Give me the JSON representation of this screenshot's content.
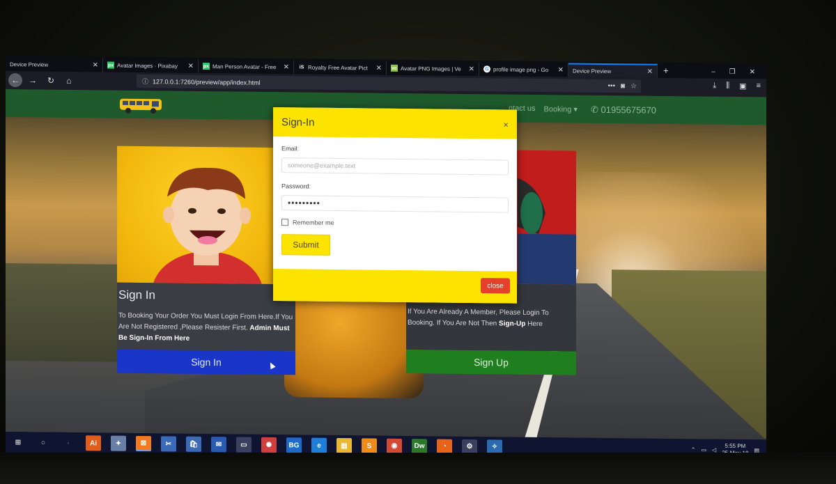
{
  "browser": {
    "tabs": [
      {
        "label": "Device Preview",
        "favicon": "",
        "active": false
      },
      {
        "label": "Avatar Images · Pixabay",
        "favicon": "px",
        "active": false
      },
      {
        "label": "Man Person Avatar - Free",
        "favicon": "px",
        "active": false
      },
      {
        "label": "Royalty Free Avatar Pict",
        "favicon": "iS",
        "active": false
      },
      {
        "label": "Avatar PNG Images | Ve",
        "favicon": "vc",
        "active": false
      },
      {
        "label": "profile image png - Go",
        "favicon": "G",
        "active": false
      },
      {
        "label": "Device Preview",
        "favicon": "",
        "active": true
      }
    ],
    "new_tab": "+",
    "url": "127.0.0.1:7260/preview/app/index.html",
    "url_actions": [
      "•••",
      "pocket-icon",
      "star-icon"
    ],
    "window_buttons": [
      "–",
      "❐",
      "✕"
    ]
  },
  "site": {
    "nav_links": [
      "ntact us",
      "Booking ▾"
    ],
    "phone": "✆ 01955675670",
    "left_card": {
      "title": "Sign In",
      "text": "To Booking Your Order You Must Login From Here.If You Are Not Registered ,Please Resister First.",
      "text_bold": "Admin Must Be Sign-In From Here",
      "button": "Sign In"
    },
    "right_card": {
      "text": "If You Are Already A Member, Please Login To Booking. If You Are Not Then",
      "text_bold": "Sign-Up",
      "text_tail": "Here",
      "button": "Sign Up"
    }
  },
  "modal": {
    "title": "Sign-In",
    "close_x": "×",
    "email_label": "Email:",
    "email_placeholder": "someone@example.text",
    "password_label": "Password:",
    "password_value": "•••••••••",
    "remember_label": "Remember me",
    "submit_label": "Submit",
    "close_label": "close"
  },
  "taskbar": {
    "apps": [
      {
        "name": "illustrator",
        "glyph": "Ai",
        "color": "#e35d1a"
      },
      {
        "name": "app-bird",
        "glyph": "✦",
        "color": "#6a7fa8"
      },
      {
        "name": "xampp",
        "glyph": "⊠",
        "color": "#f47a20"
      },
      {
        "name": "snip",
        "glyph": "✂",
        "color": "#3a6ab8"
      },
      {
        "name": "store",
        "glyph": "🛍",
        "color": "#3a6ab8"
      },
      {
        "name": "mail",
        "glyph": "✉",
        "color": "#2a5bb0"
      },
      {
        "name": "screen",
        "glyph": "▭",
        "color": "#3a4060"
      },
      {
        "name": "network",
        "glyph": "✺",
        "color": "#d04040"
      },
      {
        "name": "bg",
        "glyph": "BG",
        "color": "#1e6ac8"
      },
      {
        "name": "edge",
        "glyph": "e",
        "color": "#1e7fd8"
      },
      {
        "name": "explorer",
        "glyph": "▤",
        "color": "#e8b830"
      },
      {
        "name": "sublime",
        "glyph": "S",
        "color": "#ef8b1a"
      },
      {
        "name": "chrome",
        "glyph": "◉",
        "color": "#d44836"
      },
      {
        "name": "dreamweaver",
        "glyph": "Dw",
        "color": "#2a7a2a"
      },
      {
        "name": "firefox",
        "glyph": "◔",
        "color": "#e8631a"
      },
      {
        "name": "settings",
        "glyph": "⚙",
        "color": "#3a4060"
      },
      {
        "name": "app-bird2",
        "glyph": "✧",
        "color": "#2a6ab0"
      }
    ],
    "clock_time": "5:55 PM",
    "clock_date": "25-May-18"
  }
}
